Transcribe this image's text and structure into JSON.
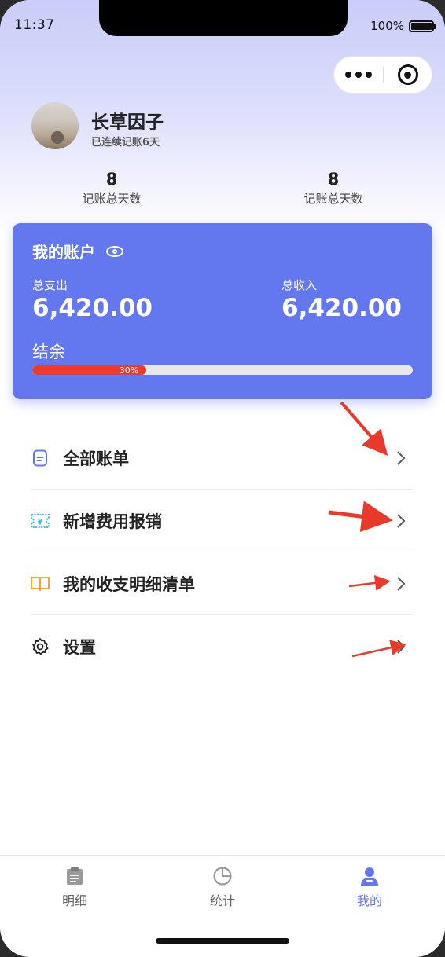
{
  "status_bar": {
    "time": "11:37",
    "battery": "100%"
  },
  "profile": {
    "name": "长草因子",
    "streak": "已连续记账6天"
  },
  "stats": [
    {
      "value": "8",
      "label": "记账总天数"
    },
    {
      "value": "8",
      "label": "记账总天数"
    }
  ],
  "account_card": {
    "title": "我的账户",
    "expense_label": "总支出",
    "expense_value": "6,420.00",
    "income_label": "总收入",
    "income_value": "6,420.00",
    "balance_label": "结余",
    "progress_percent": 30,
    "progress_text": "30%",
    "color": "#6378ee",
    "progress_color": "#f23a2a"
  },
  "menu": [
    {
      "label": "全部账单",
      "icon": "document-icon",
      "color": "#6378ee"
    },
    {
      "label": "新增费用报销",
      "icon": "receipt-icon",
      "color": "#3fb6e8"
    },
    {
      "label": "我的收支明细清单",
      "icon": "book-icon",
      "color": "#f0a535"
    },
    {
      "label": "设置",
      "icon": "gear-icon",
      "color": "#222222"
    }
  ],
  "tabbar": [
    {
      "label": "明细",
      "icon": "clipboard-icon"
    },
    {
      "label": "统计",
      "icon": "pie-chart-icon"
    },
    {
      "label": "我的",
      "icon": "user-icon",
      "active": true
    }
  ],
  "accent_color": "#6378ee",
  "annotation_color": "#e8392b"
}
